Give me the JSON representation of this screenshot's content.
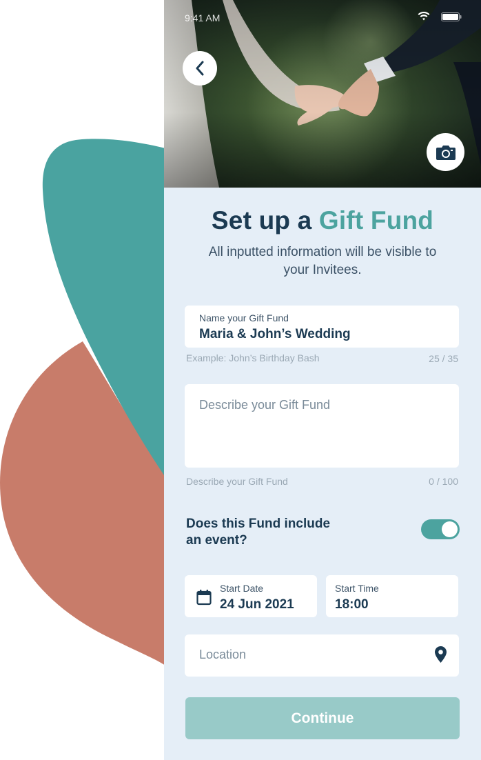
{
  "status_bar": {
    "time": "9:41 AM"
  },
  "header": {
    "title_prefix": "Set up a ",
    "title_accent": "Gift Fund",
    "subtitle": "All inputted information will be visible to your Invitees."
  },
  "name_field": {
    "label": "Name your Gift Fund",
    "value": "Maria & John’s Wedding",
    "helper": "Example: John’s Birthday Bash",
    "counter": "25 / 35"
  },
  "description_field": {
    "placeholder": "Describe your Gift Fund",
    "helper": "Describe your Gift Fund",
    "counter": "0 / 100"
  },
  "event_toggle": {
    "question": "Does this Fund include an event?",
    "enabled": true
  },
  "start_date": {
    "label": "Start Date",
    "value": "24 Jun 2021"
  },
  "start_time": {
    "label": "Start Time",
    "value": "18:00"
  },
  "location_field": {
    "placeholder": "Location"
  },
  "continue_button": {
    "label": "Continue"
  },
  "colors": {
    "accent": "#4ca39f",
    "navy": "#1b3a52",
    "panel": "#e5eef7",
    "blob_teal": "#4aa3a0",
    "blob_coral": "#c87c6a",
    "button_disabled": "#98cac8"
  },
  "icons": [
    "back-chevron-icon",
    "camera-icon",
    "calendar-icon",
    "location-pin-icon",
    "wifi-icon",
    "battery-icon"
  ]
}
